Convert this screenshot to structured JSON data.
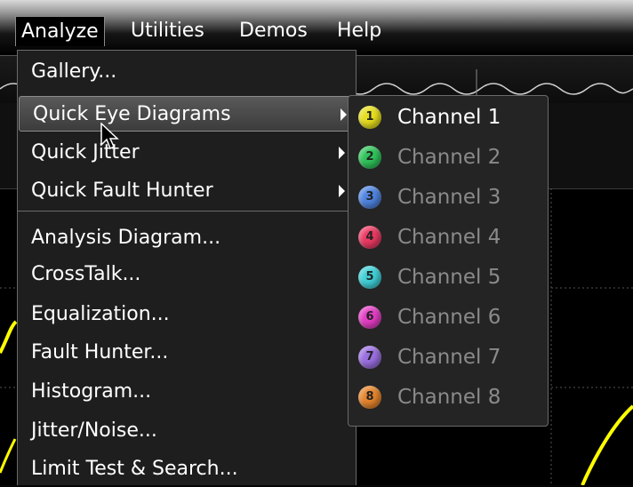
{
  "menubar": {
    "items": [
      {
        "label": "Analyze",
        "active": true
      },
      {
        "label": "Utilities"
      },
      {
        "label": "Demos"
      },
      {
        "label": "Help"
      }
    ]
  },
  "analyze_menu": {
    "items": [
      {
        "label": "Gallery..."
      },
      {
        "label": "Quick Eye Diagrams",
        "submenu": true,
        "highlighted": true
      },
      {
        "label": "Quick Jitter",
        "submenu": true
      },
      {
        "label": "Quick Fault Hunter",
        "submenu": true
      },
      {
        "label": "Analysis Diagram..."
      },
      {
        "label": "CrossTalk..."
      },
      {
        "label": "Equalization..."
      },
      {
        "label": "Fault Hunter..."
      },
      {
        "label": "Histogram..."
      },
      {
        "label": "Jitter/Noise..."
      },
      {
        "label": "Limit Test & Search..."
      }
    ]
  },
  "channel_submenu": {
    "items": [
      {
        "number": "1",
        "label": "Channel 1",
        "color": "#e6de1e",
        "enabled": true
      },
      {
        "number": "2",
        "label": "Channel 2",
        "color": "#2fc35a",
        "enabled": false
      },
      {
        "number": "3",
        "label": "Channel 3",
        "color": "#4f84e0",
        "enabled": false
      },
      {
        "number": "4",
        "label": "Channel 4",
        "color": "#ea3a62",
        "enabled": false
      },
      {
        "number": "5",
        "label": "Channel 5",
        "color": "#3fd0d6",
        "enabled": false
      },
      {
        "number": "6",
        "label": "Channel 6",
        "color": "#e33ec4",
        "enabled": false
      },
      {
        "number": "7",
        "label": "Channel 7",
        "color": "#9a6fe0",
        "enabled": false
      },
      {
        "number": "8",
        "label": "Channel 8",
        "color": "#e6852c",
        "enabled": false
      }
    ]
  },
  "colors": {
    "waveform": "#ffff00",
    "menu_bg": "#1e1e1e",
    "disabled_text": "#8a8a8a"
  }
}
